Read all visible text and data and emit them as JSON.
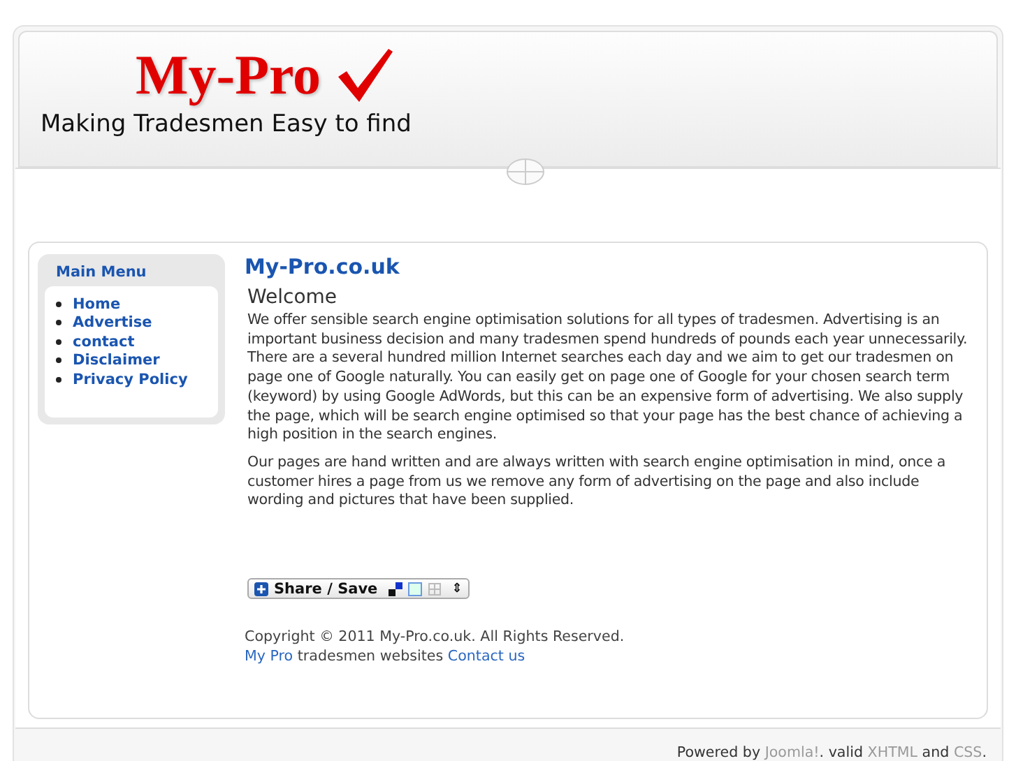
{
  "header": {
    "logo": "My-Pro",
    "tagline": "Making Tradesmen Easy to find"
  },
  "main_menu": {
    "title": "Main Menu",
    "items": [
      "Home",
      "Advertise",
      "contact",
      "Disclaimer",
      "Privacy Policy"
    ]
  },
  "content": {
    "site_title": "My-Pro.co.uk",
    "heading": "Welcome",
    "paragraphs": [
      "We offer sensible search engine optimisation solutions for all types of tradesmen. Advertising is an important business decision and many tradesmen spend hundreds of pounds each year unnecessarily. There are a several hundred million Internet searches each day and we aim to get our tradesmen on page one of Google naturally. You can easily get on page one of Google for your chosen search term (keyword) by using Google AdWords, but this can be an expensive form of advertising. We also supply the page, which will be search engine optimised so that your page has the best chance of achieving a high position in the search engines.",
      "Our pages are hand written and are always written with search engine optimisation in mind, once a customer hires a page from us we remove any form of advertising on the page and also include wording and pictures that have been supplied."
    ],
    "share_button": "Share / Save",
    "share_caret": "⇕",
    "copyright": "Copyright © 2011 My-Pro.co.uk. All Rights Reserved.",
    "credit": [
      {
        "kind": "link",
        "text": "My Pro"
      },
      {
        "kind": "text",
        "text": "tradesmen websites"
      },
      {
        "kind": "link",
        "text": "Contact us"
      }
    ]
  },
  "footer": [
    {
      "kind": "text",
      "text": "Powered by"
    },
    {
      "kind": "link",
      "text": "Joomla!"
    },
    {
      "kind": "text",
      "text": ". valid"
    },
    {
      "kind": "link",
      "text": "XHTML"
    },
    {
      "kind": "text",
      "text": "and"
    },
    {
      "kind": "link",
      "text": "CSS"
    },
    {
      "kind": "text",
      "text": "."
    }
  ]
}
